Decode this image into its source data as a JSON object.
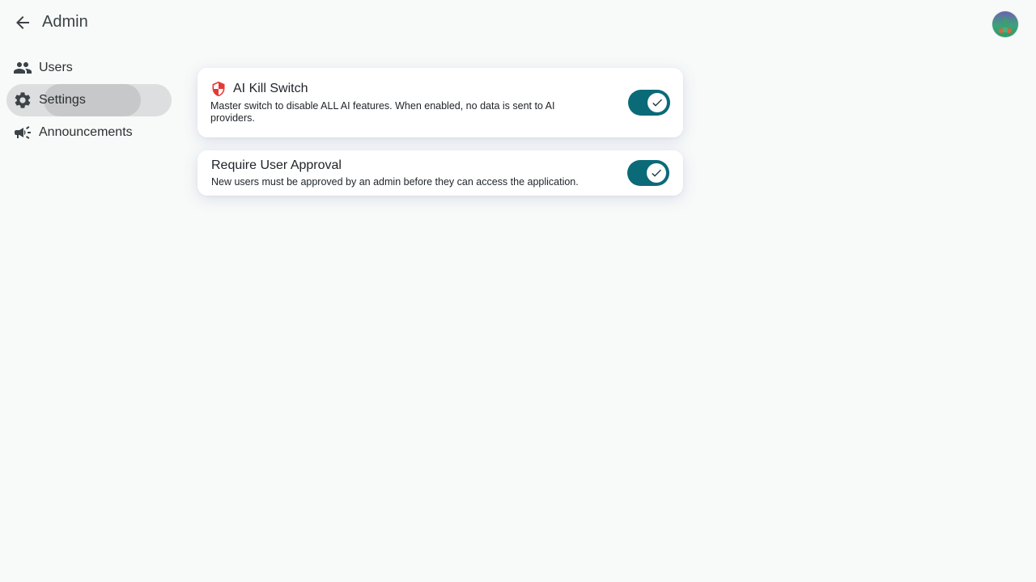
{
  "header": {
    "back_icon": "arrow-back-icon",
    "title": "Admin",
    "avatar_icon": "user-avatar"
  },
  "sidebar": {
    "items": [
      {
        "label": "Users",
        "icon": "group-icon",
        "active": false
      },
      {
        "label": "Settings",
        "icon": "gear-icon",
        "active": true
      },
      {
        "label": "Announcements",
        "icon": "campaign-icon",
        "active": false
      }
    ]
  },
  "settings": {
    "ai_kill_switch": {
      "icon": "shield-icon",
      "title": "AI Kill Switch",
      "description": "Master switch to disable ALL AI features. When enabled, no data is sent to AI providers.",
      "enabled": true
    },
    "require_user_approval": {
      "title": "Require User Approval",
      "description": "New users must be approved by an admin before they can access the application.",
      "enabled": true
    }
  },
  "colors": {
    "accent": "#0b6a78",
    "shield": "#e53935",
    "background": "#f8faf9"
  }
}
